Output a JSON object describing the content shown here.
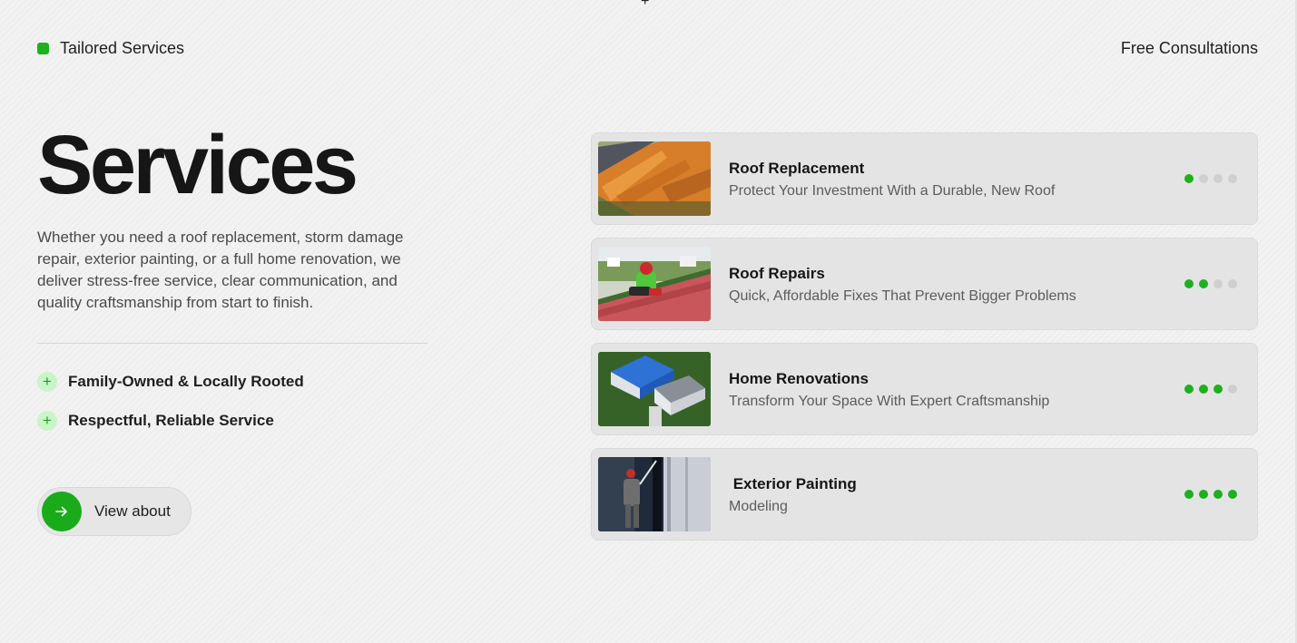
{
  "top_marker": "+",
  "header": {
    "tag_label": "Tailored Services",
    "consult_label": "Free Consultations"
  },
  "hero": {
    "title": "Services",
    "description": "Whether you need a roof replacement, storm damage repair, exterior painting, or a full home renovation, we deliver stress-free service, clear communication, and quality craftsmanship from start to finish."
  },
  "features": [
    {
      "icon": "plus-icon",
      "label": "Family-Owned & Locally Rooted"
    },
    {
      "icon": "plus-icon",
      "label": "Respectful, Reliable Service"
    }
  ],
  "cta": {
    "icon": "arrow-right-icon",
    "label": "View about"
  },
  "services": [
    {
      "title": "Roof Replacement",
      "subtitle": "Protect Your Investment With a Durable, New Roof",
      "step": 1,
      "total": 4
    },
    {
      "title": "Roof Repairs",
      "subtitle": "Quick, Affordable Fixes That Prevent Bigger Problems",
      "step": 2,
      "total": 4
    },
    {
      "title": "Home Renovations",
      "subtitle": "Transform Your Space With Expert Craftsmanship",
      "step": 3,
      "total": 4
    },
    {
      "title": " Exterior Painting",
      "subtitle": "Modeling",
      "step": 4,
      "total": 4
    }
  ],
  "colors": {
    "accent": "#1db11d",
    "accent_light": "#c9f5c9",
    "dot_inactive": "#cfcfcf"
  }
}
